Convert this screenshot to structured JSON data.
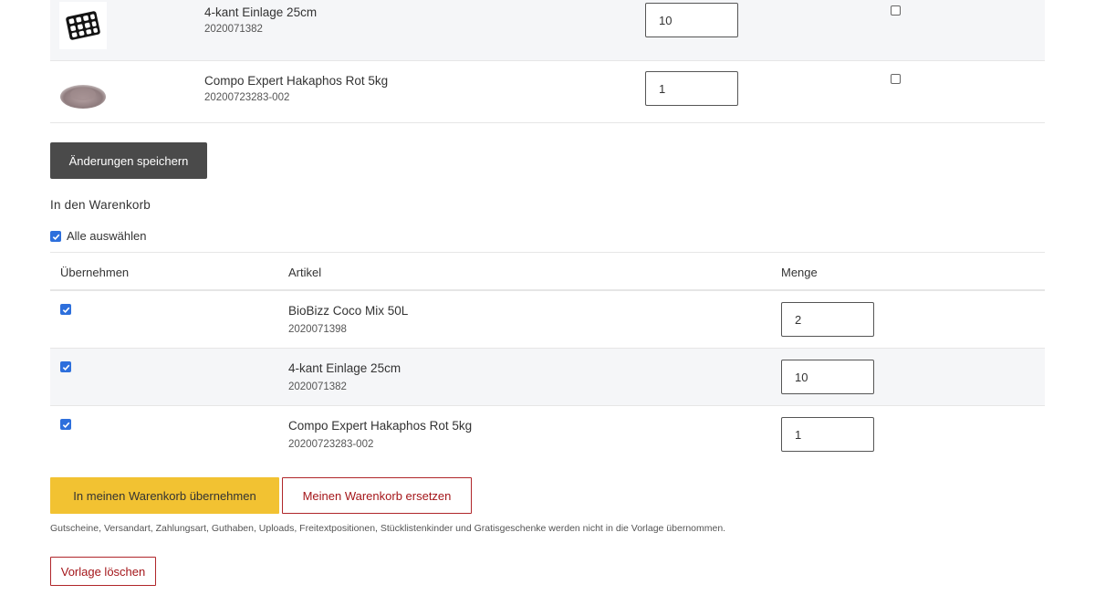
{
  "top_items": [
    {
      "name": "4-kant Einlage 25cm",
      "number": "2020071382",
      "qty": "10",
      "image": "grid-insert-image"
    },
    {
      "name": "Compo Expert Hakaphos Rot 5kg",
      "number": "20200723283-002",
      "qty": "1",
      "image": "fertilizer-pile-image"
    }
  ],
  "save_button": "Änderungen speichern",
  "cart_section": {
    "title": "In den Warenkorb",
    "select_all": "Alle auswählen",
    "headers": {
      "take": "Übernehmen",
      "article": "Artikel",
      "qty": "Menge"
    },
    "rows": [
      {
        "name": "BioBizz Coco Mix 50L",
        "number": "2020071398",
        "qty": "2",
        "checked": true
      },
      {
        "name": "4-kant Einlage 25cm",
        "number": "2020071382",
        "qty": "10",
        "checked": true
      },
      {
        "name": "Compo Expert Hakaphos Rot 5kg",
        "number": "20200723283-002",
        "qty": "1",
        "checked": true
      }
    ]
  },
  "actions": {
    "add_to_cart": "In meinen Warenkorb übernehmen",
    "replace_cart": "Meinen Warenkorb ersetzen",
    "note": "Gutscheine, Versandart, Zahlungsart, Guthaben, Uploads, Freitextpositionen, Stücklistenkinder und Gratisgeschenke werden nicht in die Vorlage übernommen.",
    "delete_template": "Vorlage löschen"
  },
  "colors": {
    "accent_yellow": "#f2c232",
    "danger_red": "#a4161a",
    "checkbox_blue": "#2d6fdc",
    "dark_button": "#4a4a4a"
  }
}
